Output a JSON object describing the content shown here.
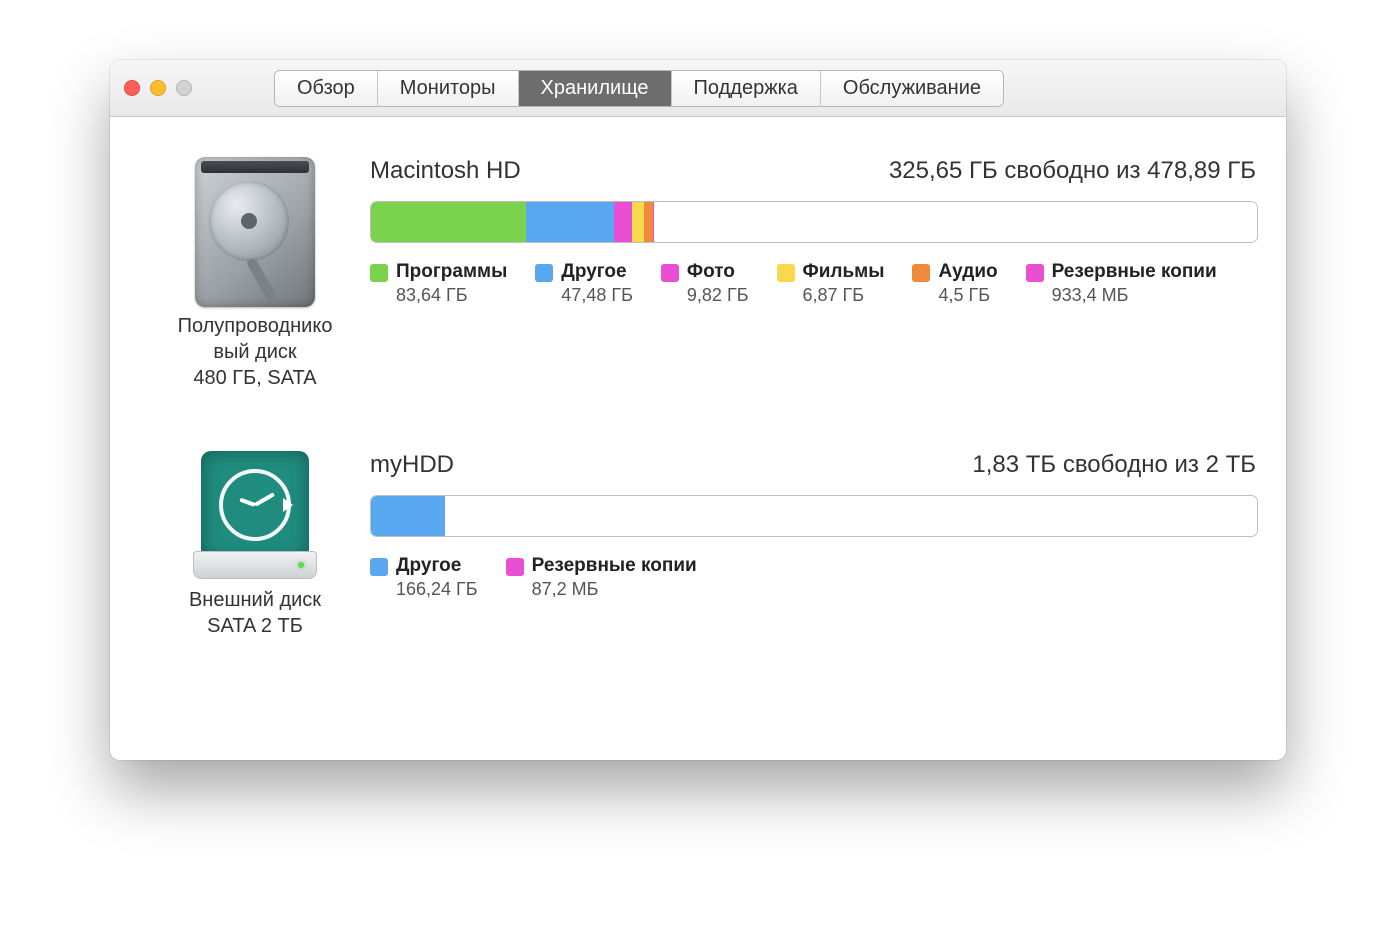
{
  "tabs": {
    "overview": "Обзор",
    "displays": "Мониторы",
    "storage": "Хранилище",
    "support": "Поддержка",
    "service": "Обслуживание"
  },
  "disks": [
    {
      "name": "Macintosh HD",
      "free_text": "325,65 ГБ свободно из 478,89 ГБ",
      "icon_caption_l1": "Полупроводнико",
      "icon_caption_l2": "вый диск",
      "icon_caption_l3": "480 ГБ, SATA",
      "total_gb": 478.89,
      "segments": [
        {
          "key": "apps",
          "label": "Программы",
          "size": "83,64 ГБ",
          "gb": 83.64,
          "color": "c-apps"
        },
        {
          "key": "other",
          "label": "Другое",
          "size": "47,48 ГБ",
          "gb": 47.48,
          "color": "c-other"
        },
        {
          "key": "photo",
          "label": "Фото",
          "size": "9,82 ГБ",
          "gb": 9.82,
          "color": "c-photo"
        },
        {
          "key": "movies",
          "label": "Фильмы",
          "size": "6,87 ГБ",
          "gb": 6.87,
          "color": "c-movies"
        },
        {
          "key": "audio",
          "label": "Аудио",
          "size": "4,5 ГБ",
          "gb": 4.5,
          "color": "c-audio"
        },
        {
          "key": "backup",
          "label": "Резервные копии",
          "size": "933,4 МБ",
          "gb": 0.93,
          "color": "c-backup"
        }
      ]
    },
    {
      "name": "myHDD",
      "free_text": "1,83 ТБ свободно из 2 ТБ",
      "icon_caption_l1": "Внешний диск",
      "icon_caption_l2": "SATA 2 ТБ",
      "icon_caption_l3": "",
      "total_gb": 2000,
      "segments": [
        {
          "key": "other",
          "label": "Другое",
          "size": "166,24 ГБ",
          "gb": 166.24,
          "color": "c-other"
        },
        {
          "key": "backup",
          "label": "Резервные копии",
          "size": "87,2 МБ",
          "gb": 0.087,
          "color": "c-backup"
        }
      ]
    }
  ],
  "chart_data": [
    {
      "type": "bar",
      "title": "Macintosh HD storage usage",
      "total_gb": 478.89,
      "free_gb": 325.65,
      "categories": [
        "Программы",
        "Другое",
        "Фото",
        "Фильмы",
        "Аудио",
        "Резервные копии"
      ],
      "values_gb": [
        83.64,
        47.48,
        9.82,
        6.87,
        4.5,
        0.93
      ],
      "colors": [
        "#7bd24d",
        "#58a7f0",
        "#e84fd2",
        "#f7d94b",
        "#f08a3b",
        "#e84fd2"
      ]
    },
    {
      "type": "bar",
      "title": "myHDD storage usage",
      "total_gb": 2000,
      "free_gb": 1830,
      "categories": [
        "Другое",
        "Резервные копии"
      ],
      "values_gb": [
        166.24,
        0.087
      ],
      "colors": [
        "#58a7f0",
        "#e84fd2"
      ]
    }
  ]
}
